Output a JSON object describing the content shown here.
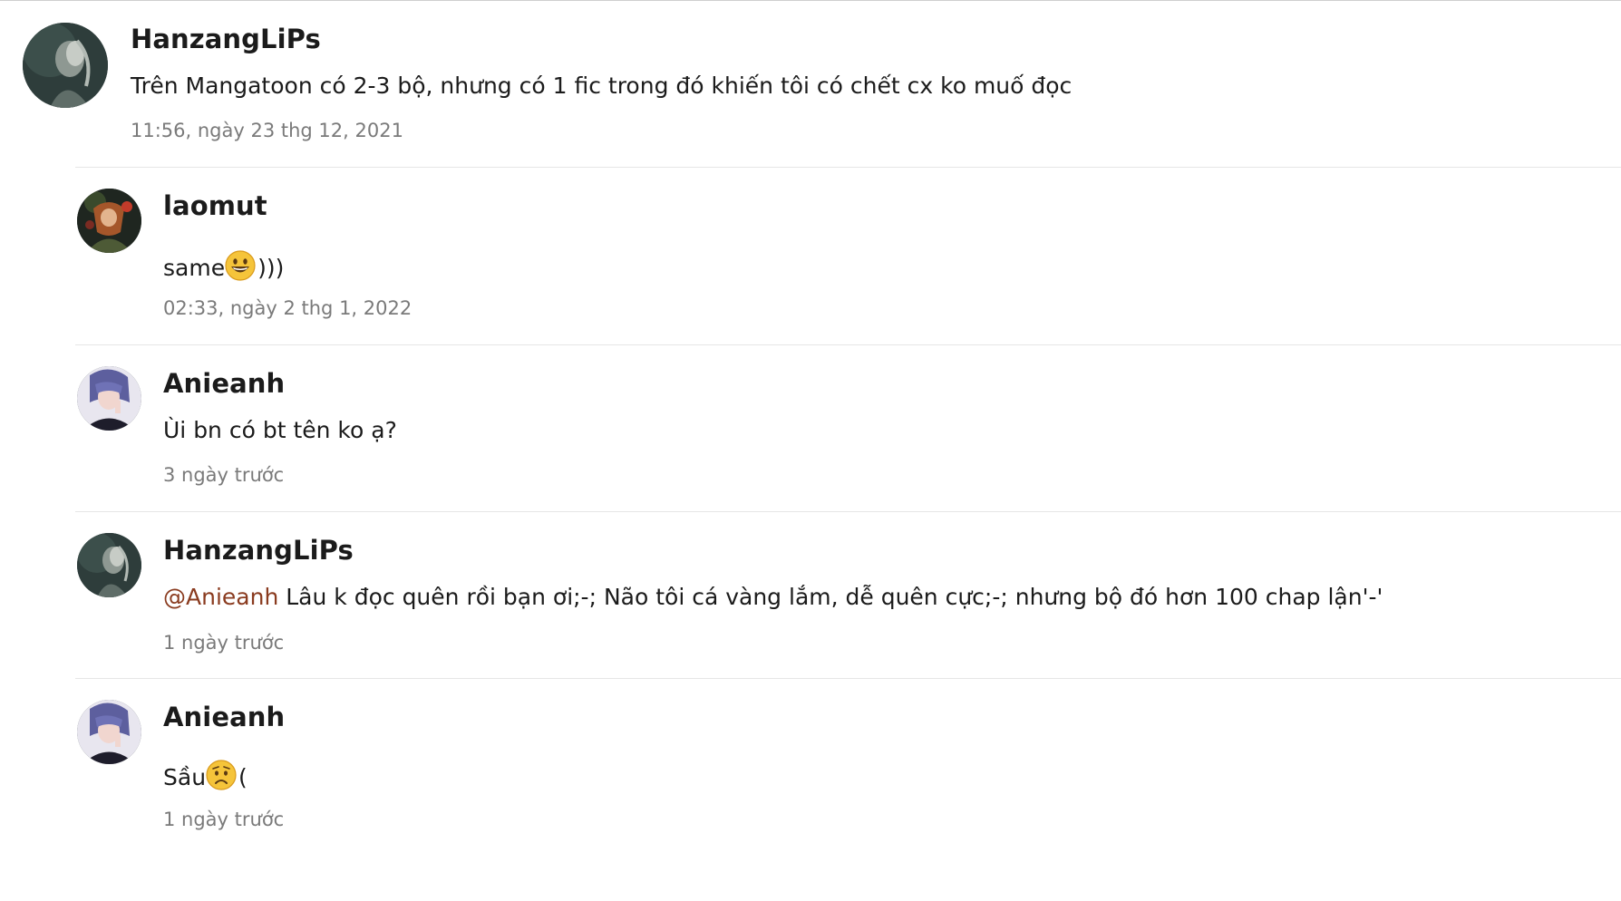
{
  "comments": [
    {
      "username": "HanzangLiPs",
      "avatar_icon": "avatar-hanzang-icon",
      "text": "Trên Mangatoon có 2-3 bộ, nhưng có 1 fic trong đó khiến tôi có chết cx ko muố đọc",
      "timestamp": "11:56, ngày 23 thg 12, 2021"
    },
    {
      "username": "laomut",
      "avatar_icon": "avatar-laomut-icon",
      "text_before_emoji": "same",
      "emoji": "grinning-face-icon",
      "text_after_emoji": ")))",
      "timestamp": "02:33, ngày 2 thg 1, 2022"
    },
    {
      "username": "Anieanh",
      "avatar_icon": "avatar-anieanh-icon",
      "text": "Ùi bn có bt tên ko ạ?",
      "timestamp": "3 ngày trước"
    },
    {
      "username": "HanzangLiPs",
      "avatar_icon": "avatar-hanzang-icon",
      "mention": "@Anieanh",
      "text": " Lâu k đọc quên rồi bạn ơi;-; Não tôi cá vàng lắm, dễ quên cực;-; nhưng bộ đó hơn 100 chap lận'-'",
      "timestamp": "1 ngày trước"
    },
    {
      "username": "Anieanh",
      "avatar_icon": "avatar-anieanh-icon",
      "text_before_emoji": "Sầu",
      "emoji": "worried-face-icon",
      "text_after_emoji": "(",
      "timestamp": "1 ngày trước"
    }
  ],
  "colors": {
    "mention": "#8a3b1f",
    "meta": "#7a7a7a",
    "divider": "#e6e6e6"
  }
}
